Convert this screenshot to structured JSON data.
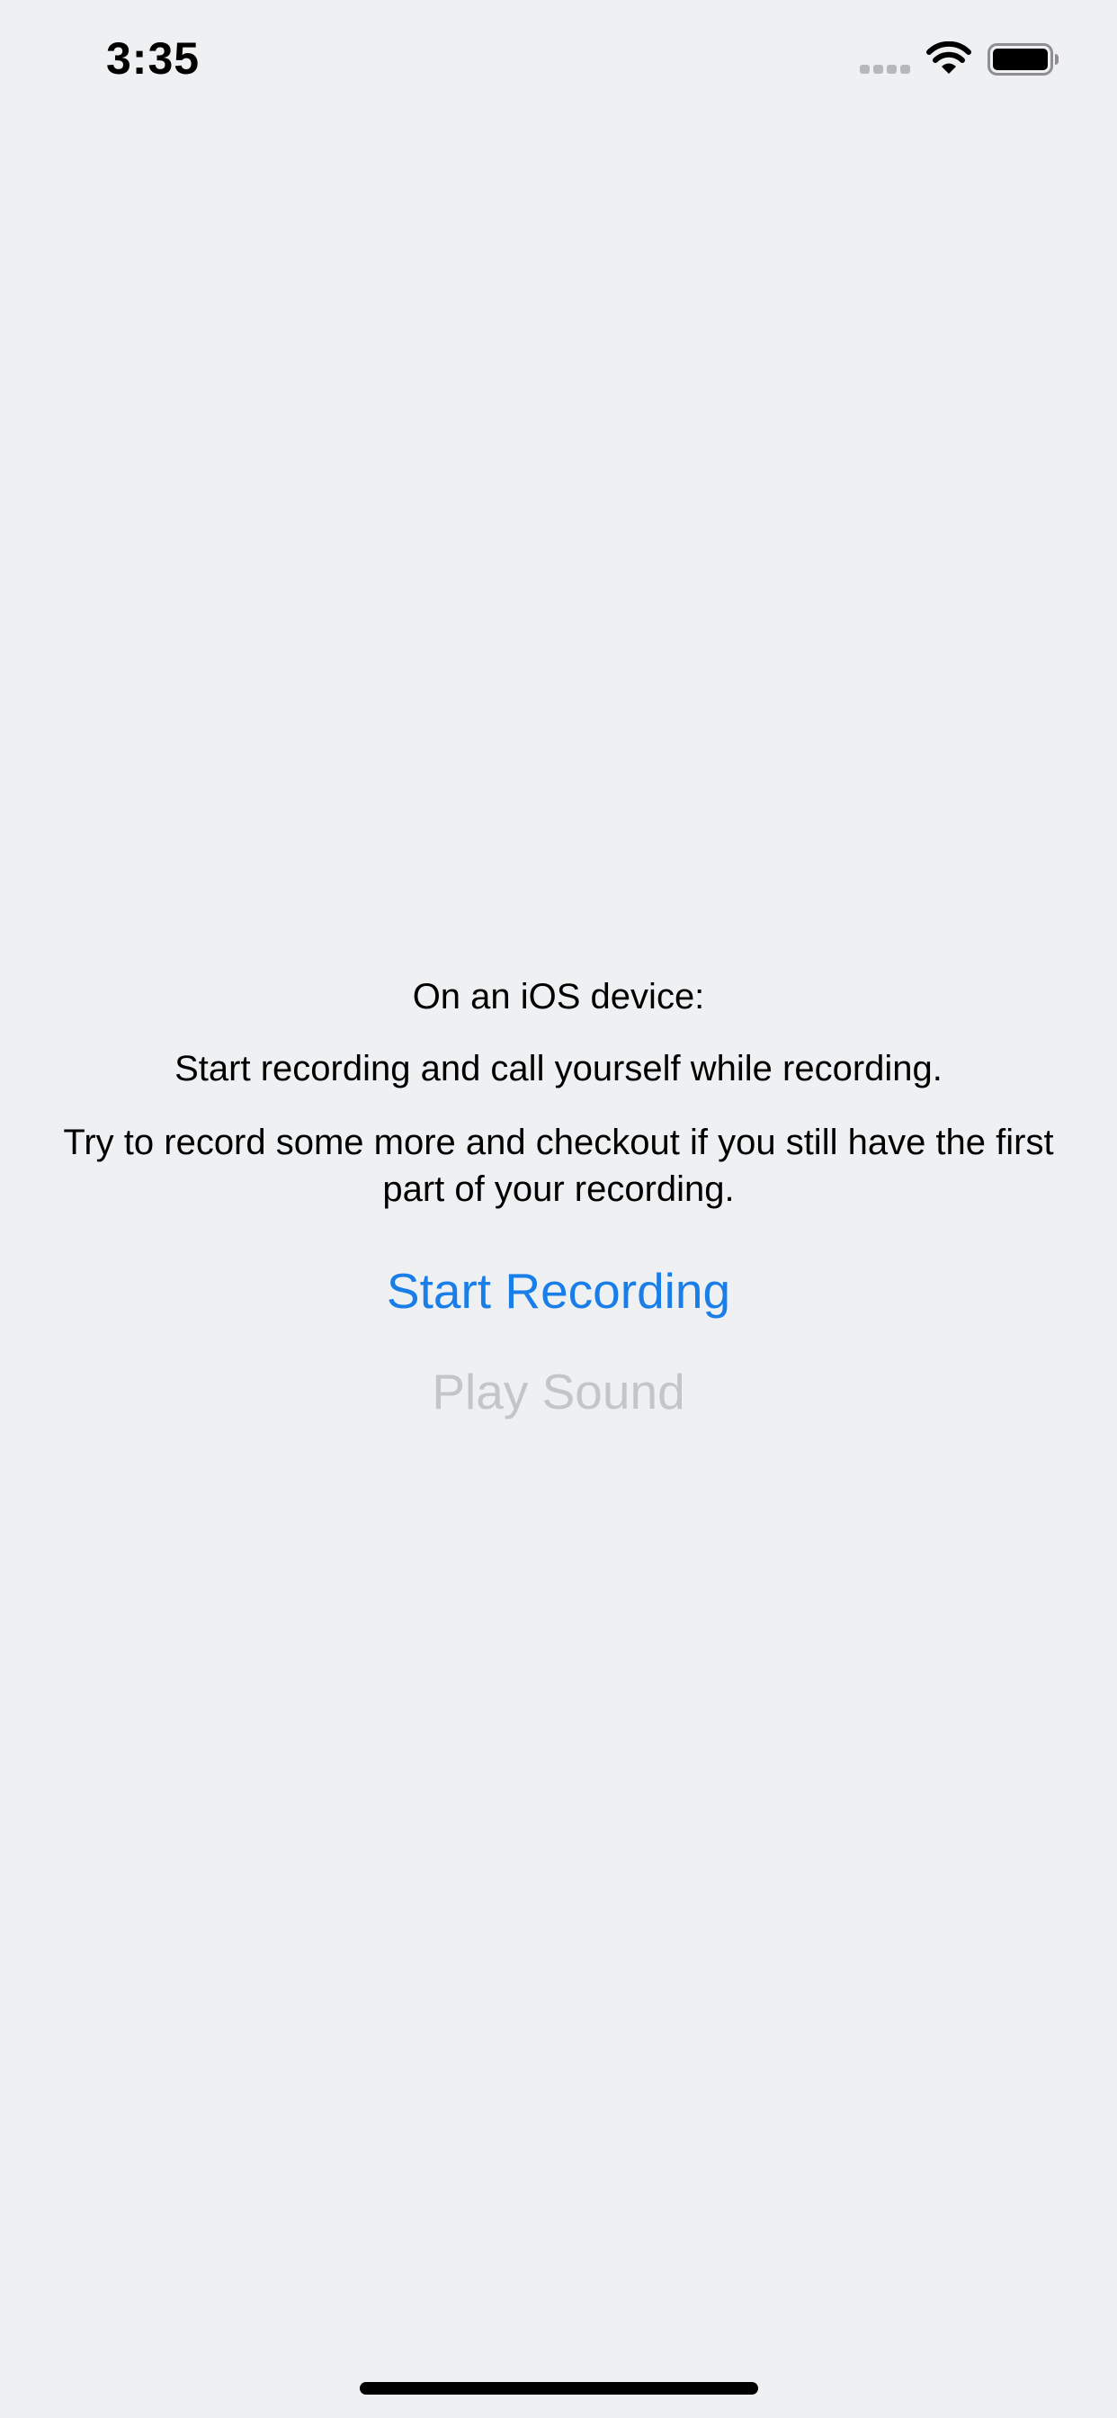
{
  "status_bar": {
    "time": "3:35",
    "signal_icon": "cellular-signal-icon",
    "wifi_icon": "wifi-icon",
    "battery_icon": "battery-icon",
    "battery_level": 1.0
  },
  "main": {
    "heading": "On an iOS device:",
    "instruction_1": "Start recording and call yourself while recording.",
    "instruction_2": "Try to record some more and checkout if you still have the first part of your recording.",
    "start_button_label": "Start Recording",
    "play_button_label": "Play Sound"
  },
  "colors": {
    "background": "#eef0f2",
    "accent": "#1a7ee8",
    "disabled": "#c3c5c8",
    "text": "#000000"
  }
}
